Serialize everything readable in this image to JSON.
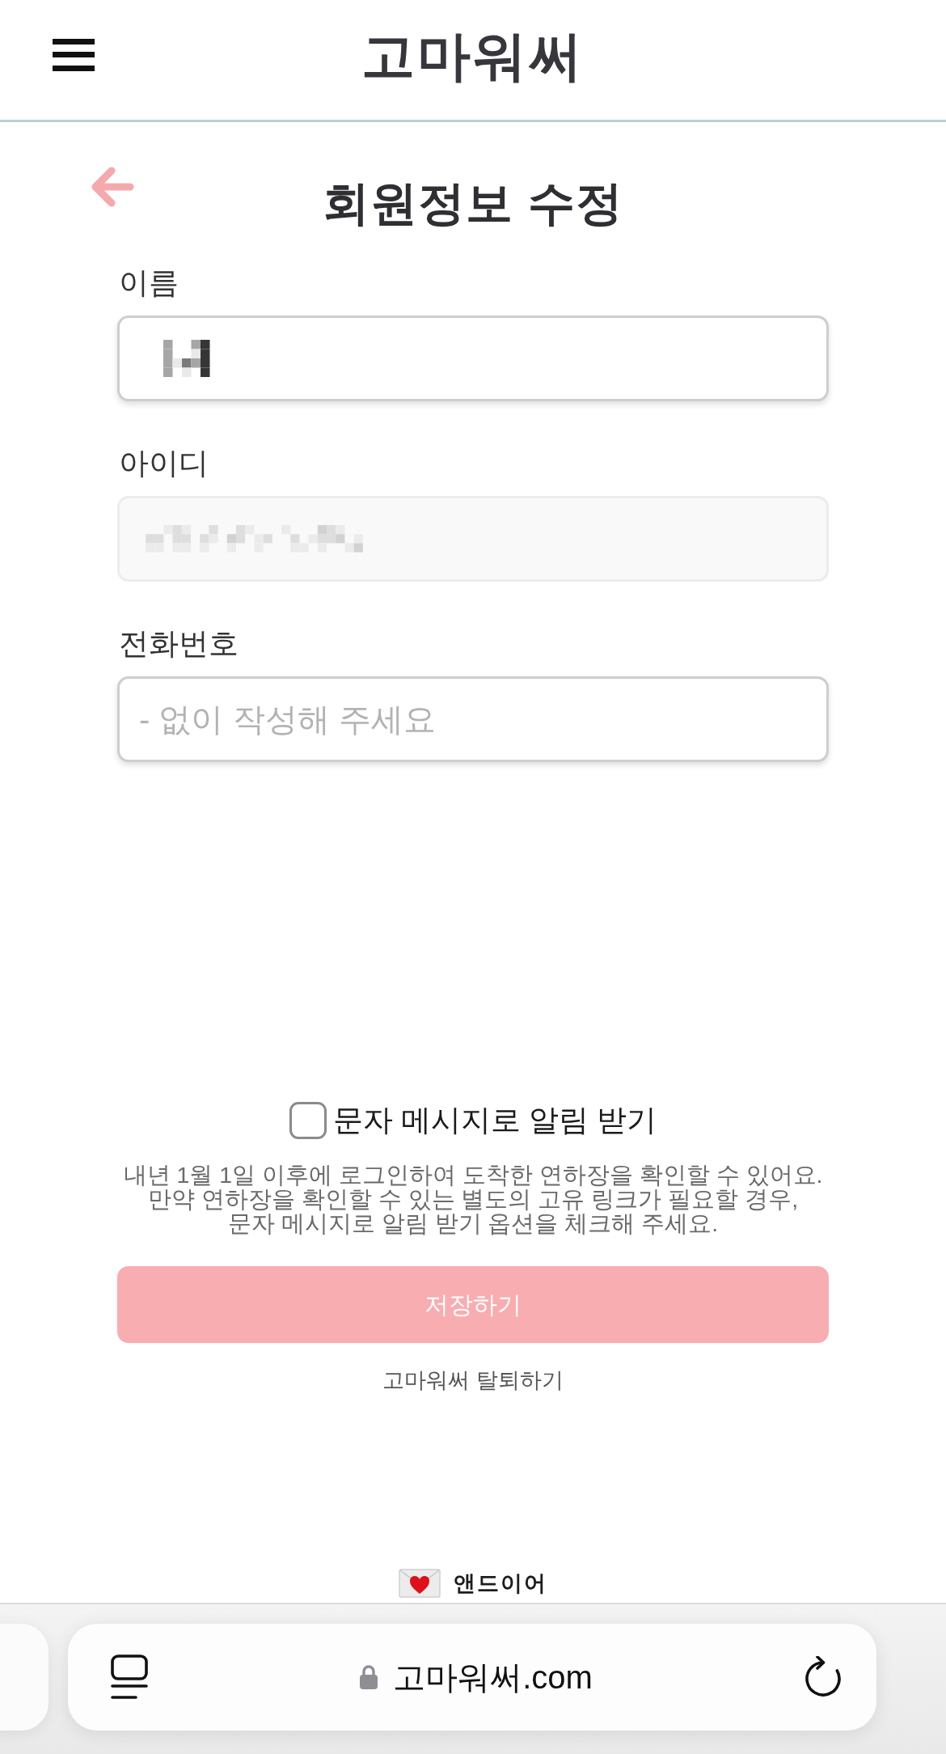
{
  "header": {
    "logo": "고마워써"
  },
  "page_title": "회원정보 수정",
  "fields": [
    {
      "label": "이름",
      "redacted": true,
      "disabled": false
    },
    {
      "label": "아이디",
      "redacted": true,
      "disabled": true
    },
    {
      "label": "전화번호",
      "placeholder": "- 없이 작성해 주세요",
      "disabled": false
    }
  ],
  "sms_option": {
    "label": "문자 메시지로 알림 받기",
    "checked": false
  },
  "notice": "내년 1월 1일 이후에 로그인하여 도착한 연하장을 확인할 수 있어요.\n만약 연하장을 확인할 수 있는 별도의 고유 링크가 필요할 경우,\n문자 메시지로 알림 받기 옵션을 체크해 주세요.",
  "save_button": {
    "label": "저장하기"
  },
  "withdraw_link": "고마워써 탈퇴하기",
  "footer": {
    "brand": "앤드이어"
  },
  "browser_bar": {
    "url": "고마워써.com"
  }
}
